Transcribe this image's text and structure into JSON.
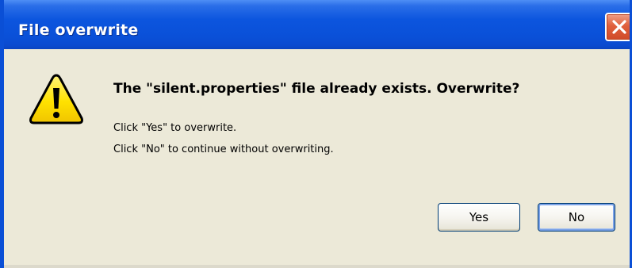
{
  "window": {
    "title": "File overwrite"
  },
  "icons": {
    "warning": "warning-icon",
    "close": "close-icon"
  },
  "message": {
    "headline": "The \"silent.properties\" file already exists. Overwrite?",
    "line1": "Click \"Yes\" to overwrite.",
    "line2": "Click \"No\" to continue without overwriting."
  },
  "buttons": {
    "yes_label": "Yes",
    "no_label": "No"
  },
  "colors": {
    "titlebar": "#0a50d8",
    "dialog_background": "#ece9d8",
    "close_button": "#e0603c",
    "warning_yellow": "#ffe200"
  }
}
